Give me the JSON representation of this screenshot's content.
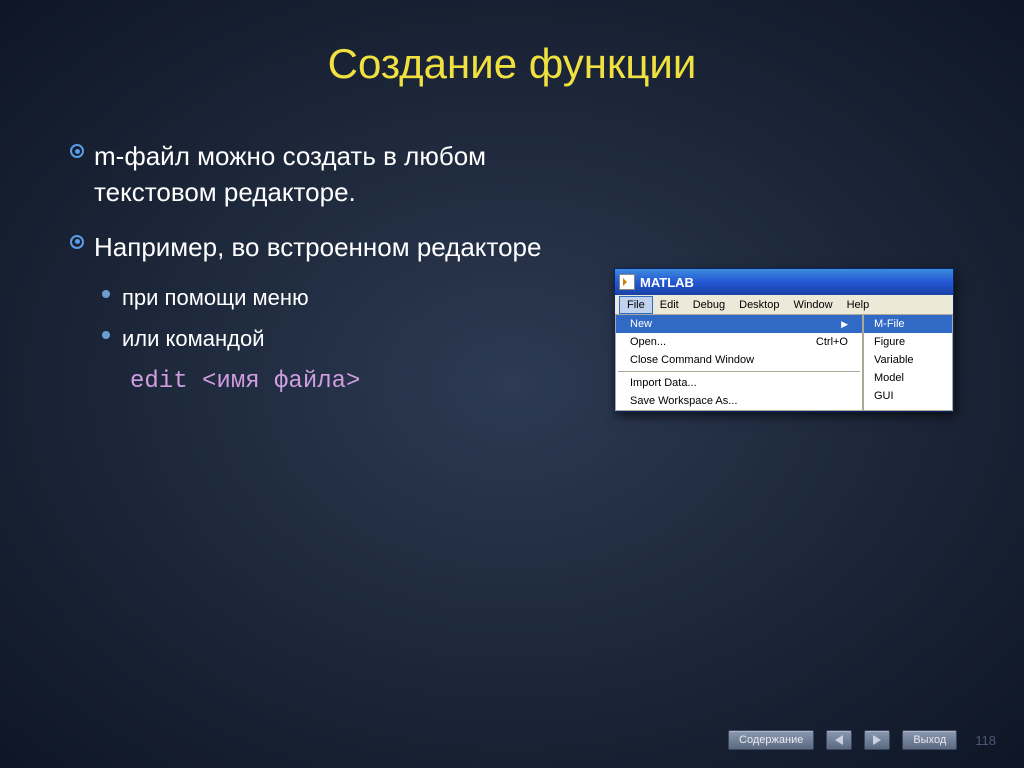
{
  "title": "Создание функции",
  "b1": "m-файл можно создать в любом текстовом редакторе.",
  "b2": "Например, во встроенном редакторе",
  "s1": "при помощи меню",
  "s2": "или командой",
  "code": "edit <имя файла>",
  "win_title": "MATLAB",
  "menu": {
    "file": "File",
    "edit": "Edit",
    "debug": "Debug",
    "desktop": "Desktop",
    "window": "Window",
    "help": "Help"
  },
  "dd": {
    "new": "New",
    "open": "Open...",
    "open_sc": "Ctrl+O",
    "close": "Close Command Window",
    "import": "Import Data...",
    "save": "Save Workspace As..."
  },
  "sub": {
    "mfile": "M-File",
    "figure": "Figure",
    "variable": "Variable",
    "model": "Model",
    "gui": "GUI"
  },
  "footer": {
    "contents": "Содержание",
    "exit": "Выход",
    "page": "118"
  }
}
